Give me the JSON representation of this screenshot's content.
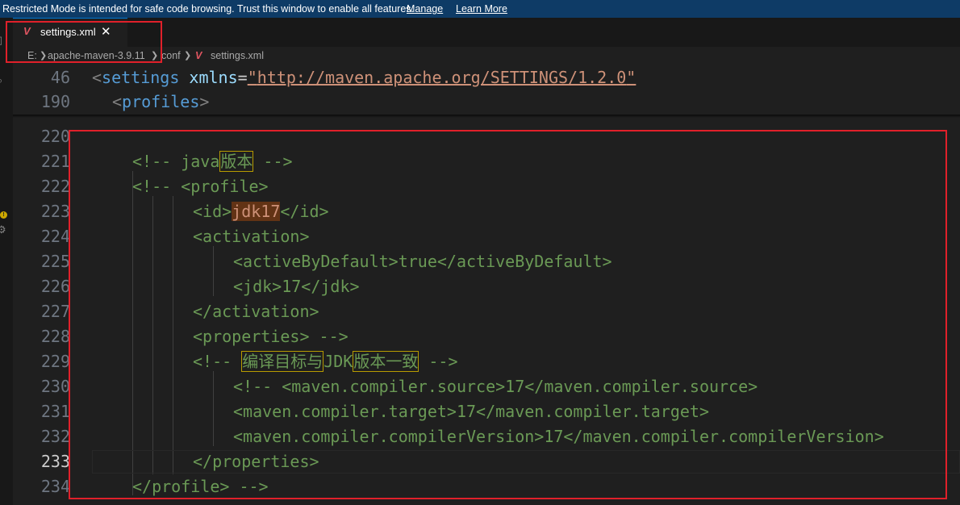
{
  "banner": {
    "message": "Restricted Mode is intended for safe code browsing. Trust this window to enable all features.",
    "manage": "Manage",
    "learn_more": "Learn More"
  },
  "tab": {
    "icon": "V",
    "label": "settings.xml",
    "close": "✕"
  },
  "breadcrumb": {
    "items": [
      "E:",
      "apache-maven-3.9.11",
      "conf",
      "settings.xml"
    ],
    "file_icon": "V"
  },
  "editor": {
    "sticky": [
      {
        "line": "46",
        "tag_open": "<",
        "tag": "settings",
        "attr": "xmlns",
        "eq": "=",
        "q1": "\"",
        "value": "http://maven.apache.org/SETTINGS/1.2.0",
        "q2": "\""
      },
      {
        "line": "190",
        "tag_open": "<",
        "tag": "profiles",
        "tag_close": ">"
      }
    ],
    "lines": [
      {
        "n": "220",
        "text": ""
      },
      {
        "n": "221",
        "text": "<!-- java版本 -->"
      },
      {
        "n": "222",
        "text": "<!-- <profile>"
      },
      {
        "n": "223",
        "text": "<id>jdk17</id>"
      },
      {
        "n": "224",
        "text": "<activation>"
      },
      {
        "n": "225",
        "text": "<activeByDefault>true</activeByDefault>"
      },
      {
        "n": "226",
        "text": "<jdk>17</jdk>"
      },
      {
        "n": "227",
        "text": "</activation>"
      },
      {
        "n": "228",
        "text": "<properties> -->"
      },
      {
        "n": "229",
        "text": "<!-- 编译目标与JDK版本一致 -->"
      },
      {
        "n": "230",
        "text": "<!-- <maven.compiler.source>17</maven.compiler.source>"
      },
      {
        "n": "231",
        "text": "<maven.compiler.target>17</maven.compiler.target>"
      },
      {
        "n": "232",
        "text": "<maven.compiler.compilerVersion>17</maven.compiler.compilerVersion>"
      },
      {
        "n": "233",
        "text": "</properties>"
      },
      {
        "n": "234",
        "text": "</profile> -->"
      }
    ],
    "active_line": "233"
  },
  "colors": {
    "banner_bg": "#0e3b66",
    "comment": "#6a9955",
    "tag_name": "#569cd6",
    "attribute": "#9cdcfe",
    "string": "#ce9178",
    "annotation_box": "#e0202a"
  }
}
